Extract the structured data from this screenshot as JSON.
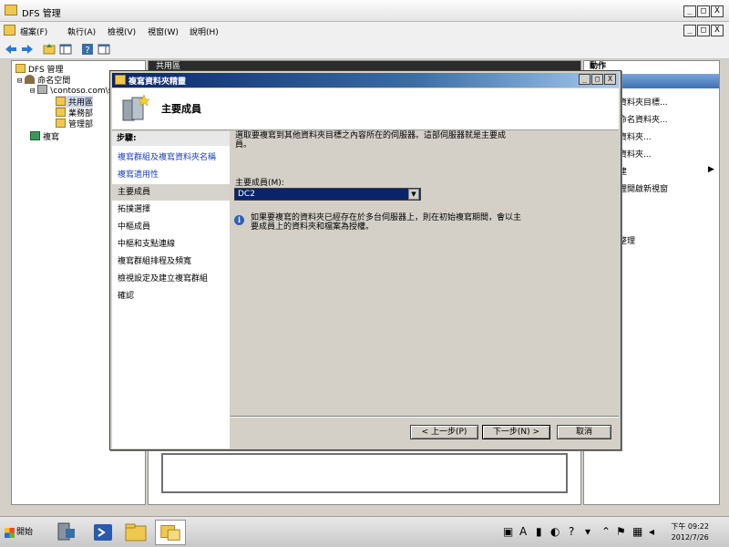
{
  "window": {
    "title": "DFS 管理",
    "cap_min": "_",
    "cap_max": "□",
    "cap_close": "X"
  },
  "menu": {
    "items": [
      "檔案(F)",
      "執行(A)",
      "檢視(V)",
      "視窗(W)",
      "說明(H)"
    ]
  },
  "tree": {
    "root": "DFS 管理",
    "namespaces": "命名空間",
    "namespace_path": "\\contoso.com\\s",
    "folders": [
      "共用區",
      "業務部",
      "管理部"
    ],
    "replication": "複寫"
  },
  "center": {
    "header": "共用區"
  },
  "actions": {
    "header": "動作",
    "items": [
      "資料夾目標...",
      "命名資料夾...",
      "資料夾...",
      "資料夾...",
      "建",
      "裡開啟新視窗",
      "",
      "整理",
      "",
      ""
    ]
  },
  "wizard": {
    "title": "複寫資料夾精靈",
    "page_header": "主要成員",
    "steps_label": "步驟:",
    "steps": [
      {
        "label": "複寫群組及複寫資料夾名稱",
        "state": "link"
      },
      {
        "label": "複寫適用性",
        "state": "link"
      },
      {
        "label": "主要成員",
        "state": "current"
      },
      {
        "label": "拓撲選擇",
        "state": "pending"
      },
      {
        "label": "中樞成員",
        "state": "pending"
      },
      {
        "label": "中樞和支點連線",
        "state": "pending"
      },
      {
        "label": "複寫群組排程及頻寬",
        "state": "pending"
      },
      {
        "label": "檢視設定及建立複寫群組",
        "state": "pending"
      },
      {
        "label": "確認",
        "state": "pending"
      }
    ],
    "description": "選取要複寫到其他資料夾目標之內容所在的伺服器。這部伺服器就是主要成員。",
    "primary_member_label": "主要成員(M):",
    "primary_member_value": "DC2",
    "info_note": "如果要複寫的資料夾已經存在於多台伺服器上，則在初始複寫期間，會以主要成員上的資料夾和檔案為授權。",
    "buttons": {
      "back": "< 上一步(P)",
      "next": "下一步(N) >",
      "cancel": "取消"
    }
  },
  "taskbar": {
    "start": "開始",
    "time": "下午 09:22",
    "date": "2012/7/26"
  }
}
